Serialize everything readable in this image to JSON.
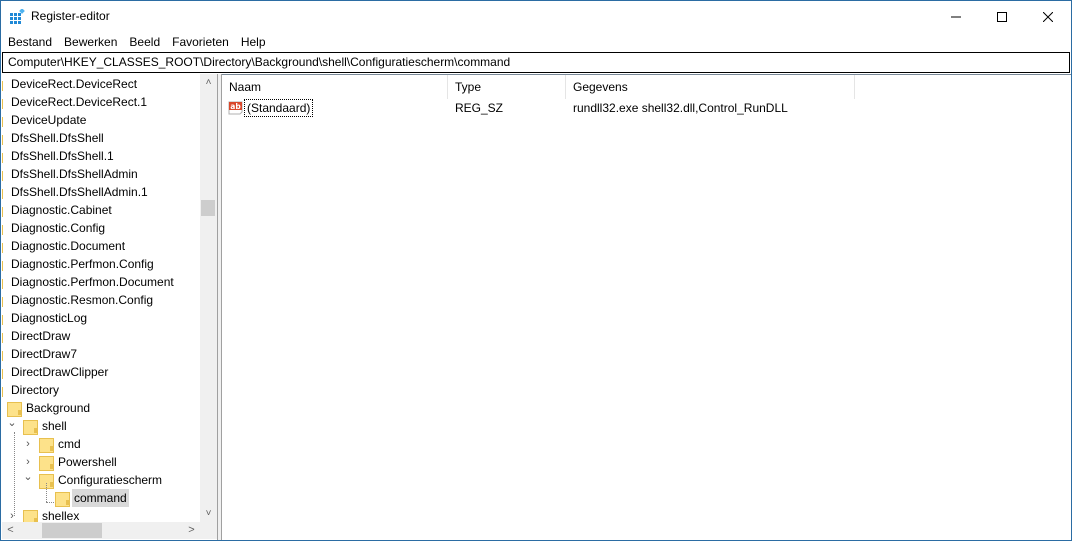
{
  "window": {
    "title": "Register-editor",
    "controls": {
      "minimize": "—",
      "maximize": "☐",
      "close": "✕"
    }
  },
  "menubar": {
    "items": [
      "Bestand",
      "Bewerken",
      "Beeld",
      "Favorieten",
      "Help"
    ]
  },
  "addressbar": {
    "path": "Computer\\HKEY_CLASSES_ROOT\\Directory\\Background\\shell\\Configuratiescherm\\command"
  },
  "tree": {
    "items": [
      {
        "label": "DeviceRect.DeviceRect",
        "depth": 0
      },
      {
        "label": "DeviceRect.DeviceRect.1",
        "depth": 0
      },
      {
        "label": "DeviceUpdate",
        "depth": 0
      },
      {
        "label": "DfsShell.DfsShell",
        "depth": 0
      },
      {
        "label": "DfsShell.DfsShell.1",
        "depth": 0
      },
      {
        "label": "DfsShell.DfsShellAdmin",
        "depth": 0
      },
      {
        "label": "DfsShell.DfsShellAdmin.1",
        "depth": 0
      },
      {
        "label": "Diagnostic.Cabinet",
        "depth": 0
      },
      {
        "label": "Diagnostic.Config",
        "depth": 0
      },
      {
        "label": "Diagnostic.Document",
        "depth": 0
      },
      {
        "label": "Diagnostic.Perfmon.Config",
        "depth": 0
      },
      {
        "label": "Diagnostic.Perfmon.Document",
        "depth": 0
      },
      {
        "label": "Diagnostic.Resmon.Config",
        "depth": 0
      },
      {
        "label": "DiagnosticLog",
        "depth": 0
      },
      {
        "label": "DirectDraw",
        "depth": 0
      },
      {
        "label": "DirectDraw7",
        "depth": 0
      },
      {
        "label": "DirectDrawClipper",
        "depth": 0
      },
      {
        "label": "Directory",
        "depth": 0
      },
      {
        "label": "Background",
        "depth": 1
      },
      {
        "label": "shell",
        "depth": 2,
        "expanded": true
      },
      {
        "label": "cmd",
        "depth": 3,
        "collapsed": true
      },
      {
        "label": "Powershell",
        "depth": 3,
        "collapsed": true
      },
      {
        "label": "Configuratiescherm",
        "depth": 3,
        "expanded": true
      },
      {
        "label": "command",
        "depth": 4,
        "selected": true
      },
      {
        "label": "shellex",
        "depth": 2,
        "collapsed": true
      }
    ]
  },
  "values": {
    "columns": [
      "Naam",
      "Type",
      "Gegevens"
    ],
    "rows": [
      {
        "icon": "string-value-icon",
        "icon_text": "ab",
        "name": "(Standaard)",
        "type": "REG_SZ",
        "data": "rundll32.exe shell32.dll,Control_RunDLL"
      }
    ]
  },
  "scrollbars": {
    "tree_vertical": {
      "up": "˄",
      "down": "˅"
    },
    "tree_horizontal": {
      "left": "<",
      "right": ">"
    }
  }
}
